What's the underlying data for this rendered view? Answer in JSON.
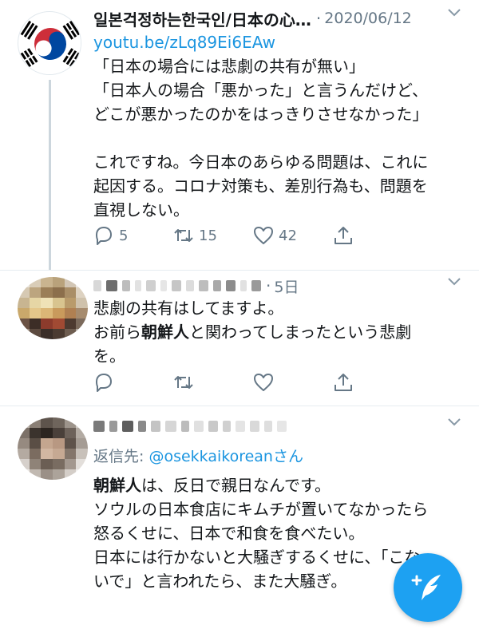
{
  "tweets": [
    {
      "author": "일본걱정하는한국인/日本の心…",
      "date": "2020/06/12",
      "link": "youtu.be/zLq89Ei6EAw",
      "text": "「日本の場合には悲劇の共有が無い」\n「日本人の場合「悪かった」と言うんだけど、\nどこが悪かったのかをはっきりさせなかった」\n\nこれですね。今日本のあらゆる問題は、これに\n起因する。コロナ対策も、差別行為も、問題を\n直視しない。",
      "replies": "5",
      "retweets": "15",
      "likes": "42"
    },
    {
      "date": "5日",
      "text_line1": "悲劇の共有はしてますよ。",
      "text_line2_pre": "お前ら",
      "text_line2_bold": "朝鮮人",
      "text_line2_post": "と関わってしまったという悲劇",
      "text_line3": "を。"
    },
    {
      "reply_prefix": "返信先: ",
      "reply_handle": "@osekkaikorean",
      "reply_suffix": "さん",
      "text_bold": "朝鮮人",
      "text_rest": "は、反日で親日なんです。\nソウルの日本食店にキムチが置いてなかったら\n怒るくせに、日本で和食を食べたい。\n日本には行かないと大騒ぎするくせに、「こな\nいで」と言われたら、また大騒ぎ。"
    }
  ],
  "icons": [
    "reply-icon",
    "retweet-icon",
    "like-icon",
    "share-icon",
    "chevron-down-icon",
    "compose-tweet-icon"
  ],
  "colors": {
    "accent": "#1da1f2",
    "link": "#1b95e0",
    "muted": "#657786",
    "text": "#14171a",
    "divider": "#e6ecf0"
  }
}
